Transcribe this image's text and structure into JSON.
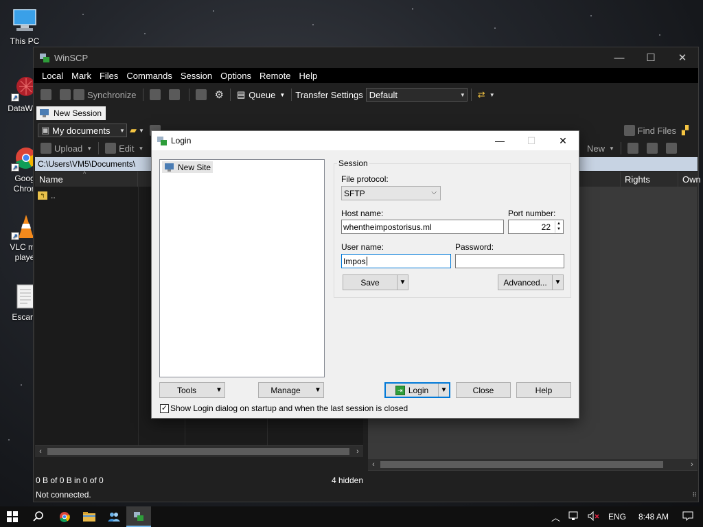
{
  "desktop": {
    "icons": [
      {
        "label": "This PC",
        "icon": "monitor-icon"
      },
      {
        "label": "DataWag",
        "icon": "datawag-icon"
      },
      {
        "label": "Goog\nChron",
        "icon": "chrome-icon"
      },
      {
        "label": "VLC me\nplaye",
        "icon": "vlc-cone-icon"
      },
      {
        "label": "Escarg",
        "icon": "document-icon"
      }
    ]
  },
  "winscp": {
    "title": "WinSCP",
    "menu": [
      "Local",
      "Mark",
      "Files",
      "Commands",
      "Session",
      "Options",
      "Remote",
      "Help"
    ],
    "toolbar": {
      "synchronize": "Synchronize",
      "queue": "Queue",
      "transfer_settings": "Transfer Settings",
      "transfer_value": "Default"
    },
    "tab": "New Session",
    "local": {
      "location": "My documents",
      "upload": "Upload",
      "edit": "Edit",
      "path": "C:\\Users\\VM5\\Documents\\",
      "col_name": "Name",
      "parent_dir": "..",
      "status": "0 B of 0 B in 0 of 0",
      "hidden": "4 hidden"
    },
    "remote": {
      "find_files": "Find Files",
      "new": "New",
      "col_rights": "Rights",
      "col_owner": "Own"
    },
    "status": "Not connected."
  },
  "login": {
    "title": "Login",
    "sites": [
      "New Site"
    ],
    "session_group": "Session",
    "file_protocol_label": "File protocol:",
    "file_protocol": "SFTP",
    "host_label": "Host name:",
    "host": "whentheimpostorisus.ml",
    "port_label": "Port number:",
    "port": "22",
    "user_label": "User name:",
    "user": "Impos",
    "password_label": "Password:",
    "password": "",
    "save": "Save",
    "advanced": "Advanced...",
    "tools": "Tools",
    "manage": "Manage",
    "login_btn": "Login",
    "close": "Close",
    "help": "Help",
    "show_on_startup": "Show Login dialog on startup and when the last session is closed",
    "show_on_startup_checked": true
  },
  "taskbar": {
    "language": "ENG",
    "time": "8:48 AM"
  },
  "colors": {
    "accent": "#0078d7",
    "path_bar": "#c7d3e3",
    "winscp_green": "#2e9d3a"
  }
}
